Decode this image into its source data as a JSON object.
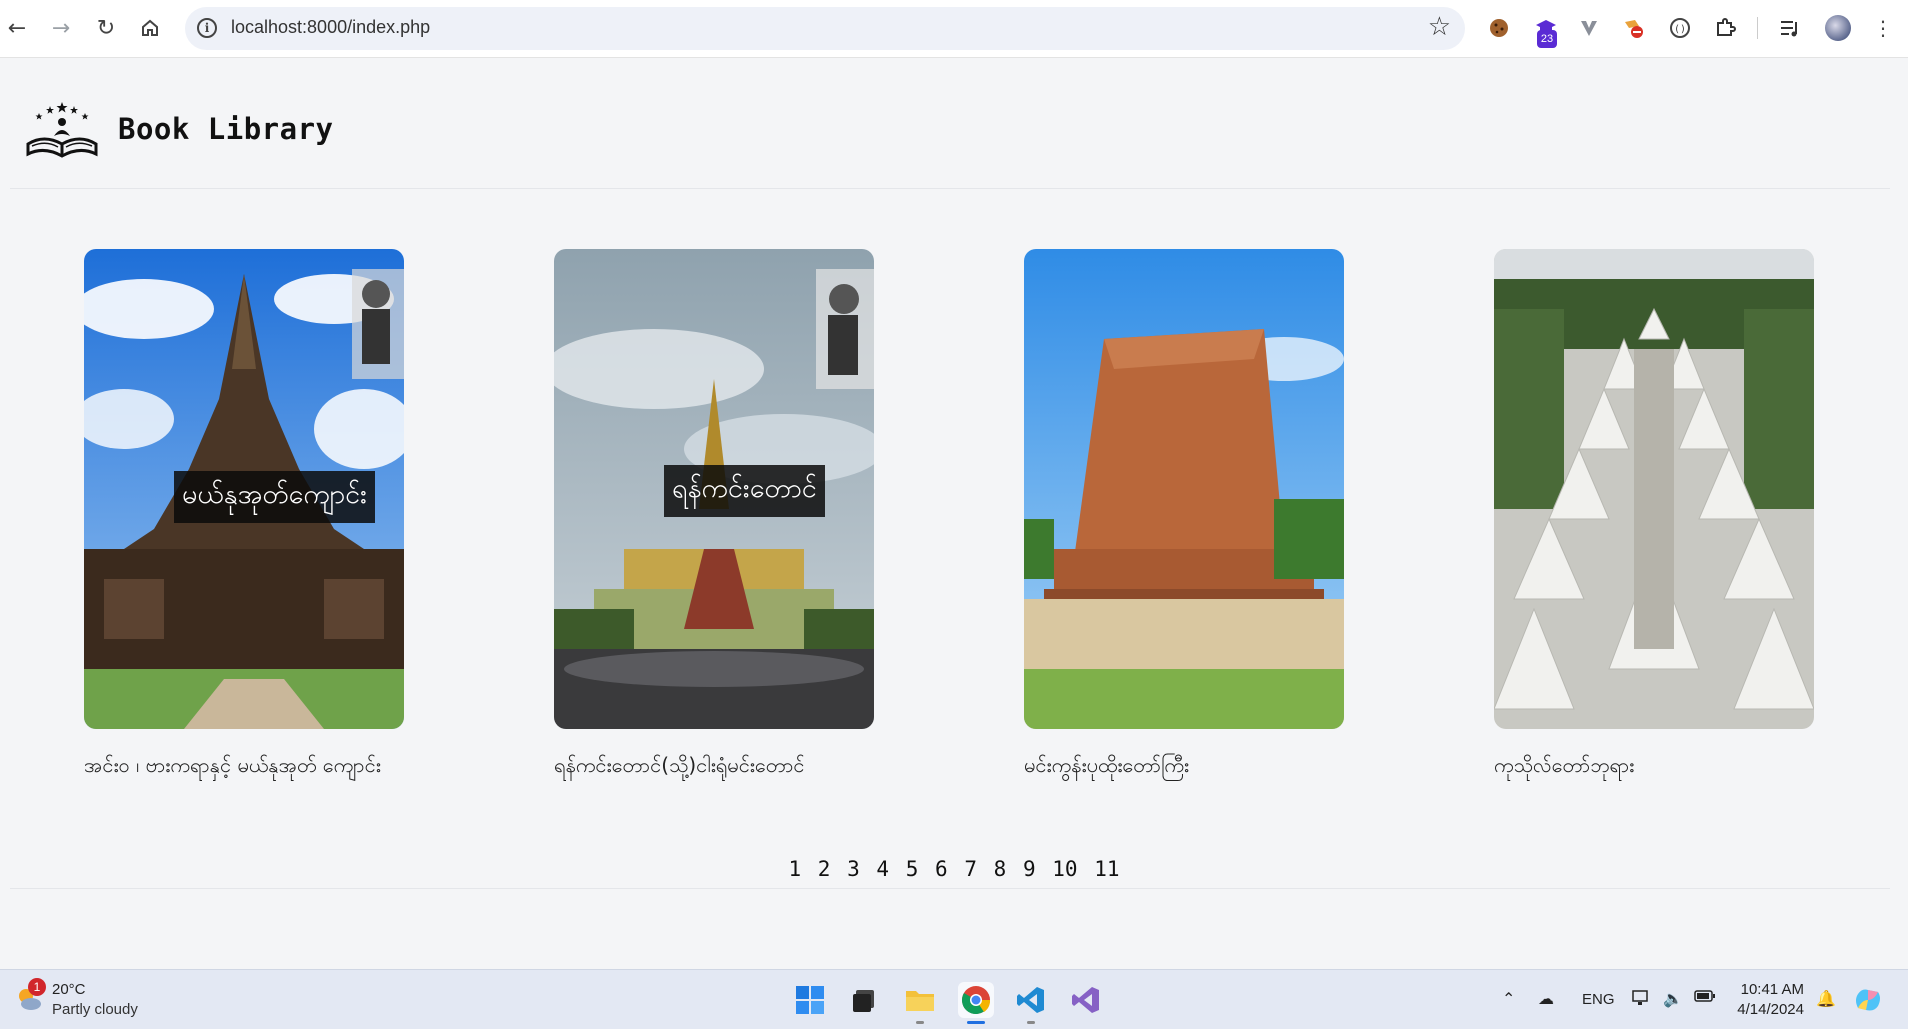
{
  "browser": {
    "url": "localhost:8000/index.php",
    "extension_badge": "23"
  },
  "header": {
    "title": "Book Library",
    "logo_icon": "open-book-stars-icon"
  },
  "books": [
    {
      "caption": "အင်း၀ ၊ ဗားကရာနှင့် မယ်နုအုတ် ကျောင်း",
      "overlay": "မယ်နုအုတ်ကျောင်း"
    },
    {
      "caption": "ရန်ကင်းတောင်(သို့)ငါးရုံမင်းတောင်",
      "overlay": "ရန်ကင်းတောင်"
    },
    {
      "caption": "မင်းကွန်းပုထိုးတော်ကြီး",
      "overlay": ""
    },
    {
      "caption": "ကုသိုလ်တော်ဘုရား",
      "overlay": ""
    }
  ],
  "pagination": {
    "pages": [
      "1",
      "2",
      "3",
      "4",
      "5",
      "6",
      "7",
      "8",
      "9",
      "10",
      "11"
    ]
  },
  "taskbar": {
    "weather_badge": "1",
    "temperature": "20°C",
    "condition": "Partly cloudy",
    "language": "ENG",
    "time": "10:41 AM",
    "date": "4/14/2024"
  },
  "colors": {
    "page_bg": "#f4f5f7",
    "taskbar_bg": "#e3e8f3"
  }
}
